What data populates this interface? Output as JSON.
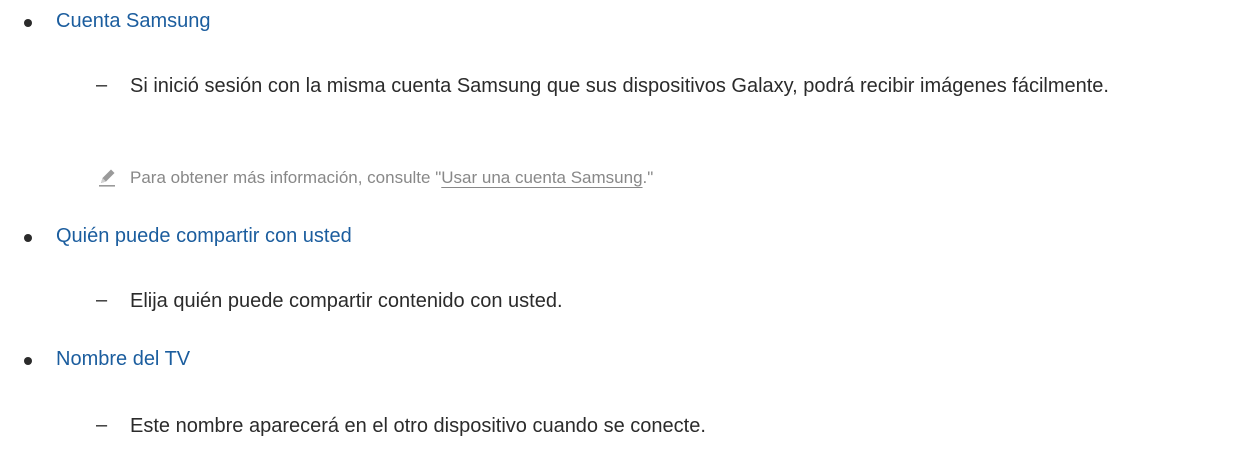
{
  "sections": [
    {
      "heading": "Cuenta Samsung",
      "description": "Si inició sesión con la misma cuenta Samsung que sus dispositivos Galaxy, podrá recibir imágenes fácilmente.",
      "note": {
        "prefix": "Para obtener más información, consulte \"",
        "link": "Usar una cuenta Samsung",
        "suffix": ".\""
      }
    },
    {
      "heading": "Quién puede compartir con usted",
      "description": "Elija quién puede compartir contenido con usted."
    },
    {
      "heading": "Nombre del TV",
      "description": "Este nombre aparecerá en el otro dispositivo cuando se conecte."
    }
  ],
  "dash_glyph": "–",
  "icons": {
    "note": "pencil-note-icon",
    "bullet": "bullet-dot"
  },
  "colors": {
    "heading": "#1b5d9e",
    "body": "#2b2b2b",
    "note": "#888888"
  }
}
